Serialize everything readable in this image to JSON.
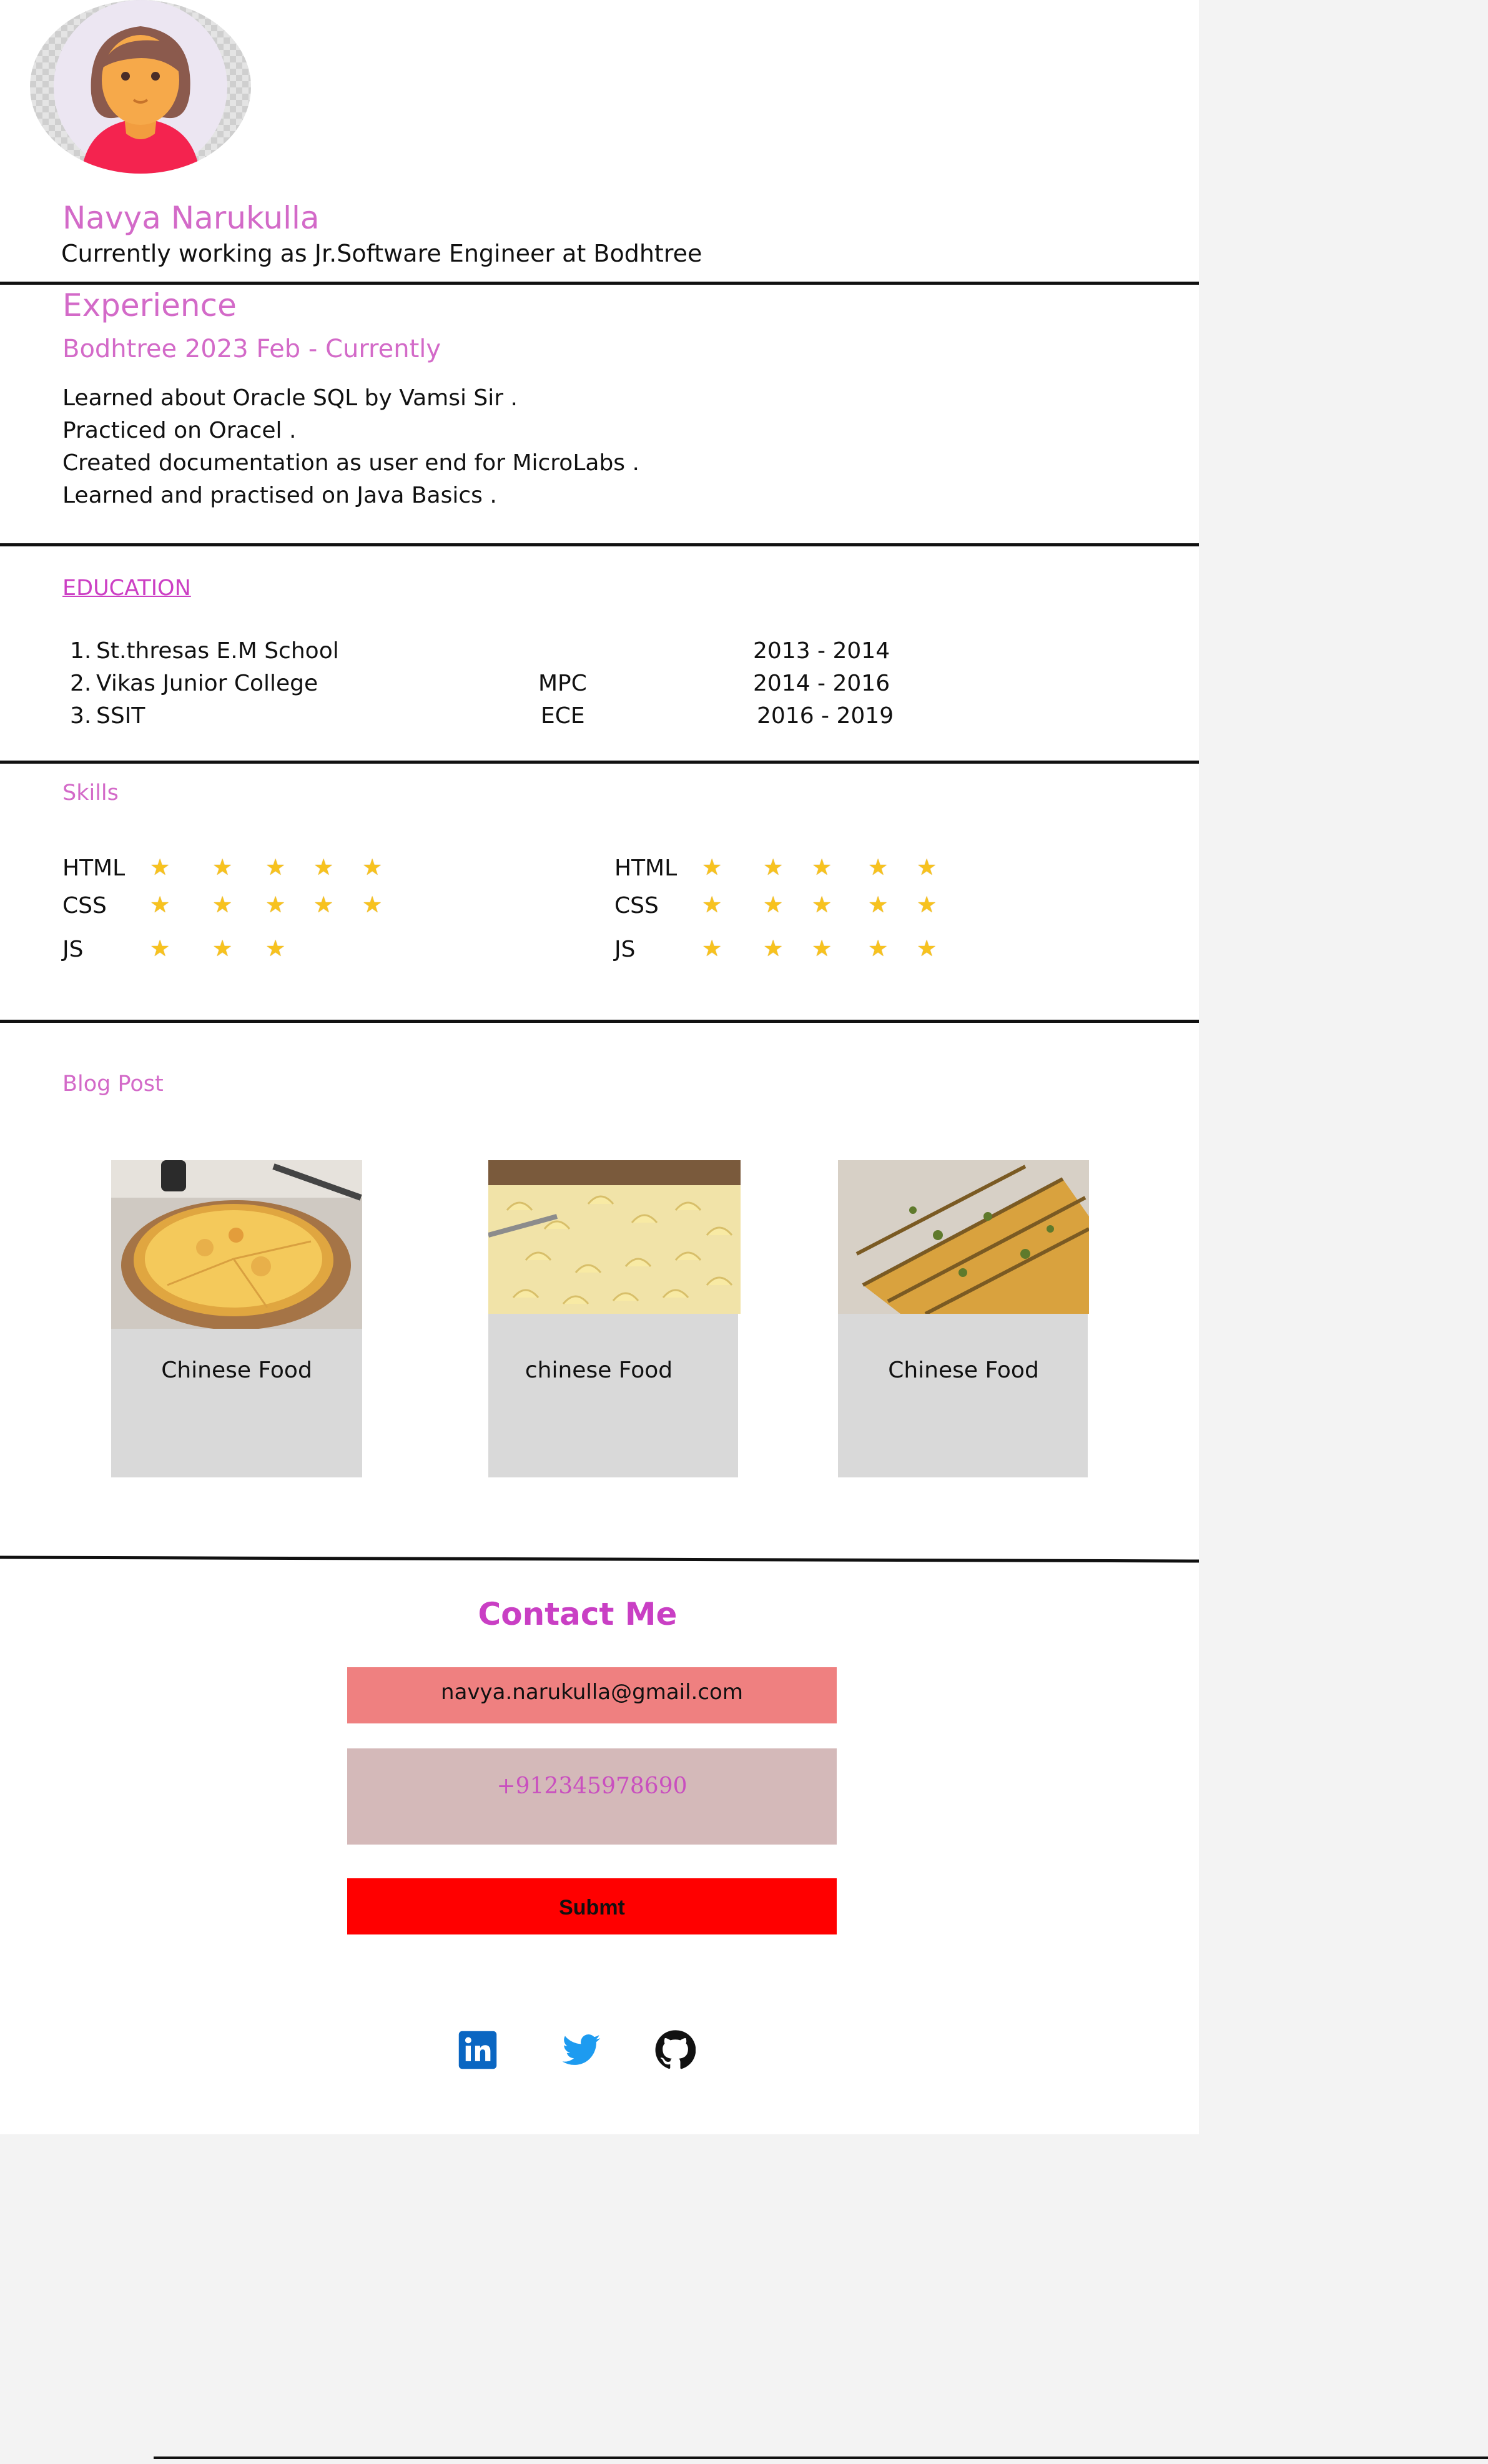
{
  "profile": {
    "name": "Navya Narukulla",
    "tagline": "Currently working as Jr.Software Engineer at Bodhtree"
  },
  "experience": {
    "heading": "Experience",
    "job": "Bodhtree 2023 Feb - Currently",
    "items": [
      "Learned about Oracle SQL by Vamsi Sir .",
      "Practiced on Oracel .",
      "Created documentation as user end for MicroLabs .",
      "Learned and practised on Java Basics ."
    ]
  },
  "education": {
    "heading": "EDUCATION",
    "rows": [
      {
        "num": "1.",
        "school": "St.thresas E.M School",
        "course": "",
        "years": "2013 - 2014"
      },
      {
        "num": "2.",
        "school": "Vikas Junior College",
        "course": "MPC",
        "years": "2014 - 2016"
      },
      {
        "num": "3.",
        "school": "SSIT",
        "course": "ECE",
        "years": "2016 - 2019"
      }
    ]
  },
  "skills": {
    "heading": "Skills",
    "star_glyph": "★",
    "left": [
      {
        "label": "HTML",
        "stars": 5
      },
      {
        "label": "CSS",
        "stars": 5
      },
      {
        "label": "JS",
        "stars": 3
      }
    ],
    "right": [
      {
        "label": "HTML",
        "stars": 5
      },
      {
        "label": "CSS",
        "stars": 5
      },
      {
        "label": "JS",
        "stars": 5
      }
    ]
  },
  "blog": {
    "heading": "Blog Post",
    "cards": [
      {
        "caption": "Chinese Food",
        "image_icon": "pizza-image"
      },
      {
        "caption": "chinese Food",
        "image_icon": "macaroni-image"
      },
      {
        "caption": "Chinese Food",
        "image_icon": "garlic-bread-image"
      }
    ]
  },
  "contact": {
    "heading": "Contact Me",
    "email": "navya.narukulla@gmail.com",
    "phone": "+912345978690",
    "submit_label": "Submt"
  },
  "social": [
    {
      "icon": "linkedin-icon",
      "color": "#0a66c2"
    },
    {
      "icon": "twitter-icon",
      "color": "#1d9bf0"
    },
    {
      "icon": "github-icon",
      "color": "#111111"
    }
  ],
  "colors": {
    "accent": "#d36ac8",
    "email_bg": "#ef8080",
    "phone_bg": "#d4b9b9",
    "submit_bg": "#ff0000",
    "card_bg": "#d9d9d9",
    "star": "#f7c21f"
  }
}
